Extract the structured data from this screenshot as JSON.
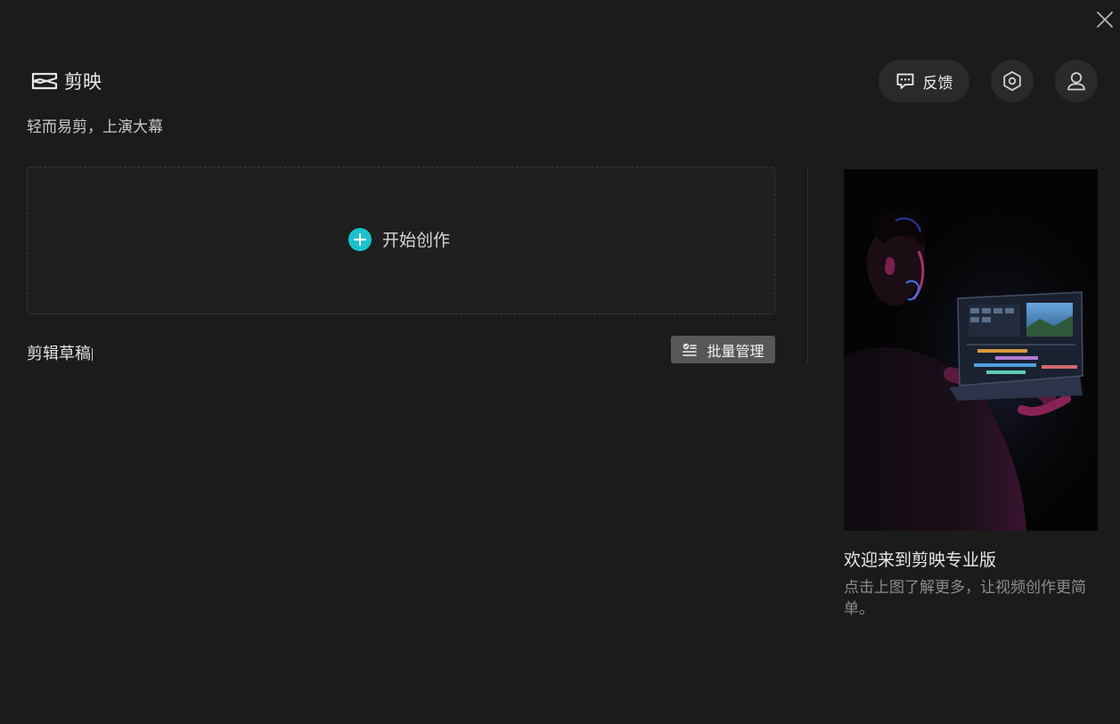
{
  "app": {
    "name": "剪映",
    "slogan": "轻而易剪，上演大幕"
  },
  "header": {
    "feedback_label": "反馈",
    "settings_icon": "hexagon-settings-icon",
    "account_icon": "user-icon",
    "close_icon": "close-icon"
  },
  "create": {
    "label": "开始创作",
    "accent": "#19c3cd"
  },
  "drafts": {
    "title": "剪辑草稿",
    "batch_label": "批量管理"
  },
  "promo": {
    "title": "欢迎来到剪映专业版",
    "description": "点击上图了解更多，让视频创作更简单。"
  }
}
